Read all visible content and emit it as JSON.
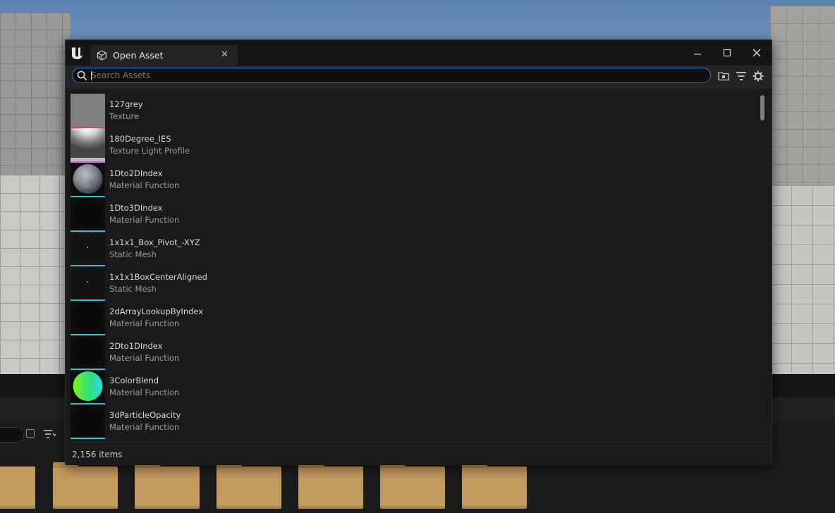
{
  "dialog": {
    "tab_title": "Open Asset",
    "search": {
      "placeholder": "Search Assets",
      "value": ""
    },
    "status_text": "2,156 items"
  },
  "assets": [
    {
      "name": "127grey",
      "type": "Texture",
      "thumb": "grey",
      "strip_color": "#d64a4a"
    },
    {
      "name": "180Degree_IES",
      "type": "Texture Light Profile",
      "thumb": "ies",
      "strip_color": "#cf5fd8"
    },
    {
      "name": "1Dto2DIndex",
      "type": "Material Function",
      "thumb": "sphere-grey",
      "strip_color": "#31c4d6"
    },
    {
      "name": "1Dto3DIndex",
      "type": "Material Function",
      "thumb": "sphere-dark",
      "strip_color": "#31c4d6"
    },
    {
      "name": "1x1x1_Box_Pivot_-XYZ",
      "type": "Static Mesh",
      "thumb": "mesh-dot",
      "strip_color": "#31c4d6"
    },
    {
      "name": "1x1x1BoxCenterAligned",
      "type": "Static Mesh",
      "thumb": "mesh-dot",
      "strip_color": "#31c4d6"
    },
    {
      "name": "2dArrayLookupByIndex",
      "type": "Material Function",
      "thumb": "sphere-dark",
      "strip_color": "#31c4d6"
    },
    {
      "name": "2Dto1DIndex",
      "type": "Material Function",
      "thumb": "sphere-dark",
      "strip_color": "#31c4d6"
    },
    {
      "name": "3ColorBlend",
      "type": "Material Function",
      "thumb": "sphere-green",
      "strip_color": "#31c4d6"
    },
    {
      "name": "3dParticleOpacity",
      "type": "Material Function",
      "thumb": "sphere-dark",
      "strip_color": "#31c4d6"
    }
  ],
  "colors": {
    "accent": "#2a7bd4",
    "folder": "#c49a5e"
  },
  "icons": [
    "ue-logo-icon",
    "asset-tab-icon",
    "close-icon",
    "minimize-icon",
    "maximize-icon",
    "search-icon",
    "folder-browse-icon",
    "filter-icon",
    "settings-gear-icon"
  ]
}
